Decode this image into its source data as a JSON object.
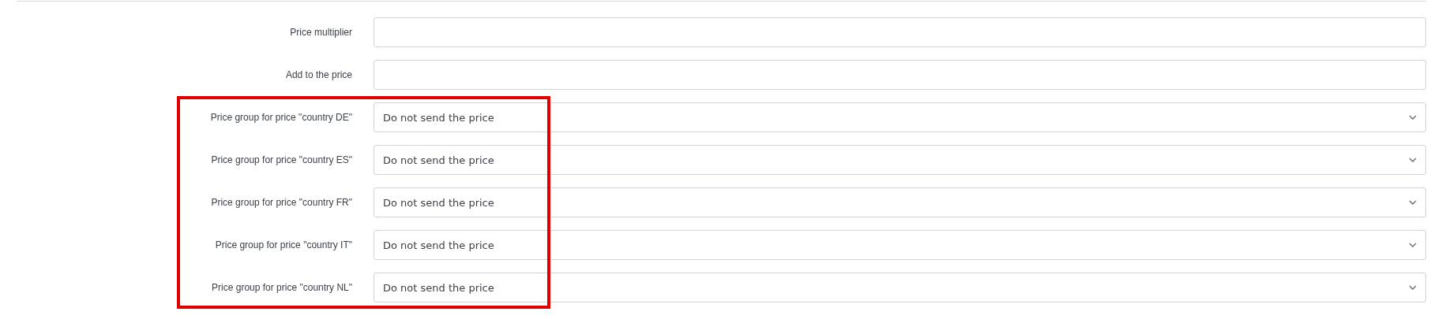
{
  "fields": [
    {
      "kind": "text",
      "label": "Price multiplier",
      "highlighted": false
    },
    {
      "kind": "text",
      "label": "Add to the price",
      "highlighted": false
    },
    {
      "kind": "select",
      "label": "Price group for price \"country DE\"",
      "value": "Do not send the price",
      "highlighted": true
    },
    {
      "kind": "select",
      "label": "Price group for price \"country ES\"",
      "value": "Do not send the price",
      "highlighted": true
    },
    {
      "kind": "select",
      "label": "Price group for price \"country FR\"",
      "value": "Do not send the price",
      "highlighted": true
    },
    {
      "kind": "select",
      "label": "Price group for price \"country IT\"",
      "value": "Do not send the price",
      "highlighted": true
    },
    {
      "kind": "select",
      "label": "Price group for price \"country NL\"",
      "value": "Do not send the price",
      "highlighted": true
    }
  ]
}
